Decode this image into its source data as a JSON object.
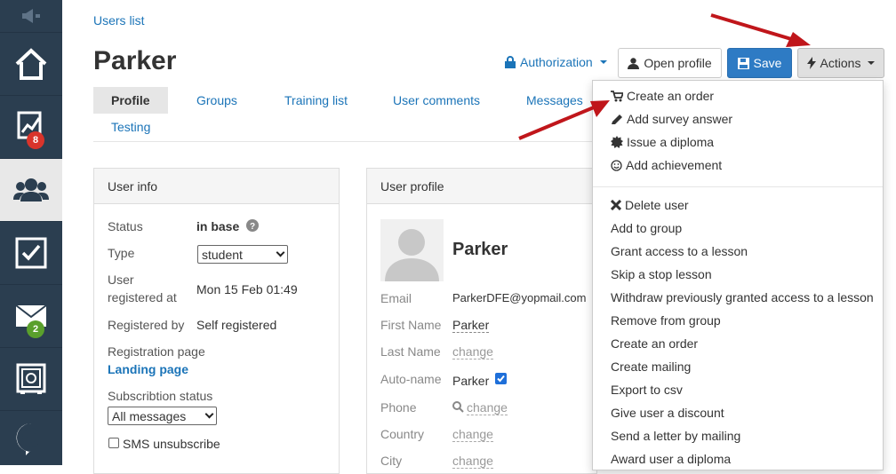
{
  "sidebar": {
    "items": [
      {
        "name": "announce-icon"
      },
      {
        "name": "home-icon"
      },
      {
        "name": "stats-icon",
        "badge": "8",
        "badge_color": "#d9342b"
      },
      {
        "name": "users-icon",
        "active": true
      },
      {
        "name": "tasks-icon"
      },
      {
        "name": "mail-icon",
        "badge": "2",
        "badge_color": "#5aa02c"
      },
      {
        "name": "safe-icon"
      },
      {
        "name": "chat-logo-icon"
      }
    ]
  },
  "breadcrumb": "Users list",
  "page_title": "Parker",
  "toolbar": {
    "authorization": "Authorization",
    "open_profile": "Open profile",
    "save": "Save",
    "actions": "Actions"
  },
  "tabs": [
    "Profile",
    "Groups",
    "Training list",
    "User comments",
    "Messages",
    "Testing"
  ],
  "user_info": {
    "heading": "User info",
    "status_label": "Status",
    "status_value": "in base",
    "type_label": "Type",
    "type_value": "student",
    "registered_label_1": "User",
    "registered_label_2": "registered at",
    "registered_value": "Mon 15 Feb 01:49",
    "registered_by_label": "Registered by",
    "registered_by_value": "Self registered",
    "reg_page_label": "Registration page",
    "reg_page_value": "Landing page",
    "subscription_label": "Subscribtion status",
    "subscription_value": "All messages",
    "sms_label": "SMS unsubscribe"
  },
  "user_profile": {
    "heading": "User profile",
    "name": "Parker",
    "email_label": "Email",
    "email_value": "ParkerDFE@yopmail.com",
    "first_name_label": "First Name",
    "first_name_value": "Parker",
    "last_name_label": "Last Name",
    "last_name_value": "change",
    "auto_name_label": "Auto-name",
    "auto_name_value": "Parker",
    "phone_label": "Phone",
    "phone_value": "change",
    "country_label": "Country",
    "country_value": "change",
    "city_label": "City",
    "city_value": "change"
  },
  "actions_menu": {
    "top": [
      "Create an order",
      "Add survey answer",
      "Issue a diploma",
      "Add achievement"
    ],
    "top_icons": [
      "cart-icon",
      "pencil-icon",
      "seal-icon",
      "smile-icon"
    ],
    "delete": "Delete user",
    "items": [
      "Add to group",
      "Grant access to a lesson",
      "Skip a stop lesson",
      "Withdraw previously granted access to a lesson",
      "Remove from group",
      "Create an order",
      "Create mailing",
      "Export to csv",
      "Give user a discount",
      "Send a letter by mailing",
      "Award user a diploma"
    ]
  },
  "colors": {
    "link": "#1b74b8",
    "primary": "#2e7bc4",
    "sidebar": "#2b3e50",
    "arrow": "#c0161b"
  }
}
